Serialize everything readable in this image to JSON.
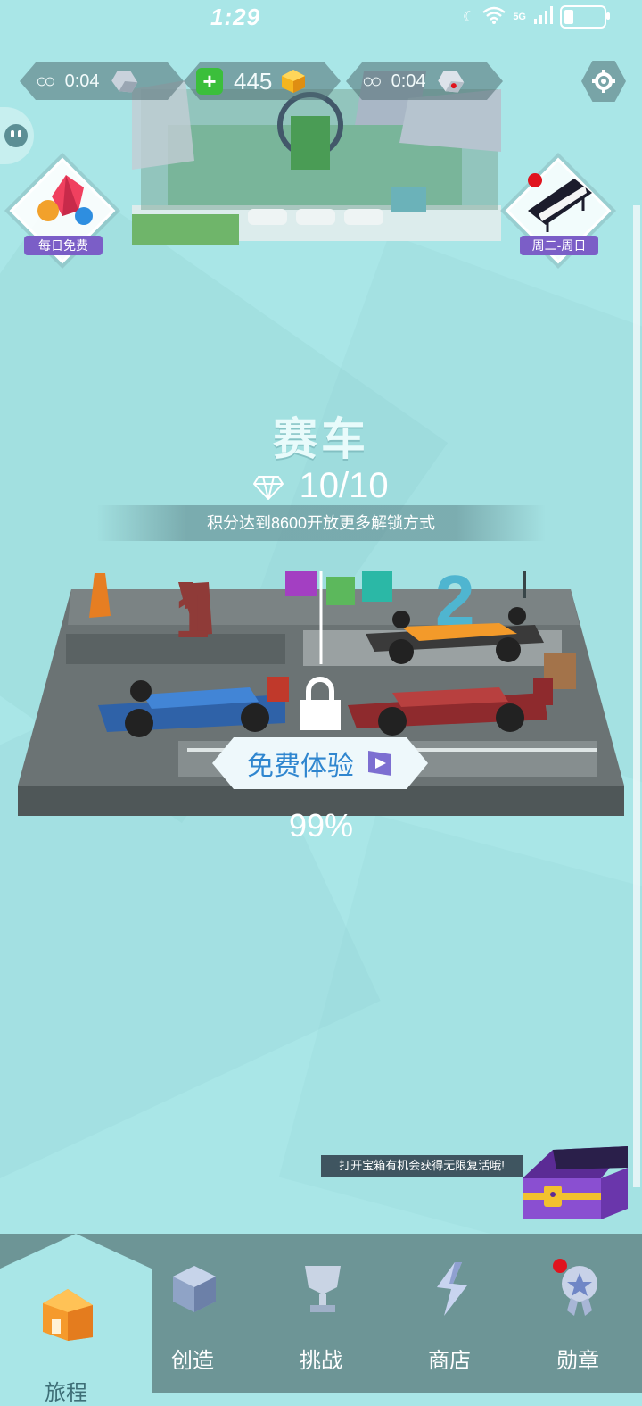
{
  "status_bar": {
    "time": "1:29",
    "signal": "5G"
  },
  "hud": {
    "infinity_left_timer": "0:04",
    "gems_count": "445",
    "infinity_right_timer": "0:04"
  },
  "badges": {
    "left_label": "每日免费",
    "right_label": "周二-周日"
  },
  "level": {
    "title": "赛车",
    "score": "10/10",
    "unlock_hint": "积分达到8600开放更多解锁方式",
    "trial_button": "免费体验",
    "progress": "99%"
  },
  "chest": {
    "tip": "打开宝箱有机会获得无限复活哦!"
  },
  "nav": {
    "items": [
      {
        "label": "旅程",
        "icon": "house-icon"
      },
      {
        "label": "创造",
        "icon": "cube-icon"
      },
      {
        "label": "挑战",
        "icon": "trophy-icon"
      },
      {
        "label": "商店",
        "icon": "lightning-icon"
      },
      {
        "label": "勋章",
        "icon": "medal-icon"
      }
    ],
    "active": 0
  },
  "colors": {
    "background": "#a9e6e7",
    "nav": "#6d9596",
    "accent": "#2f86cf",
    "badge": "#7b5ec7"
  }
}
